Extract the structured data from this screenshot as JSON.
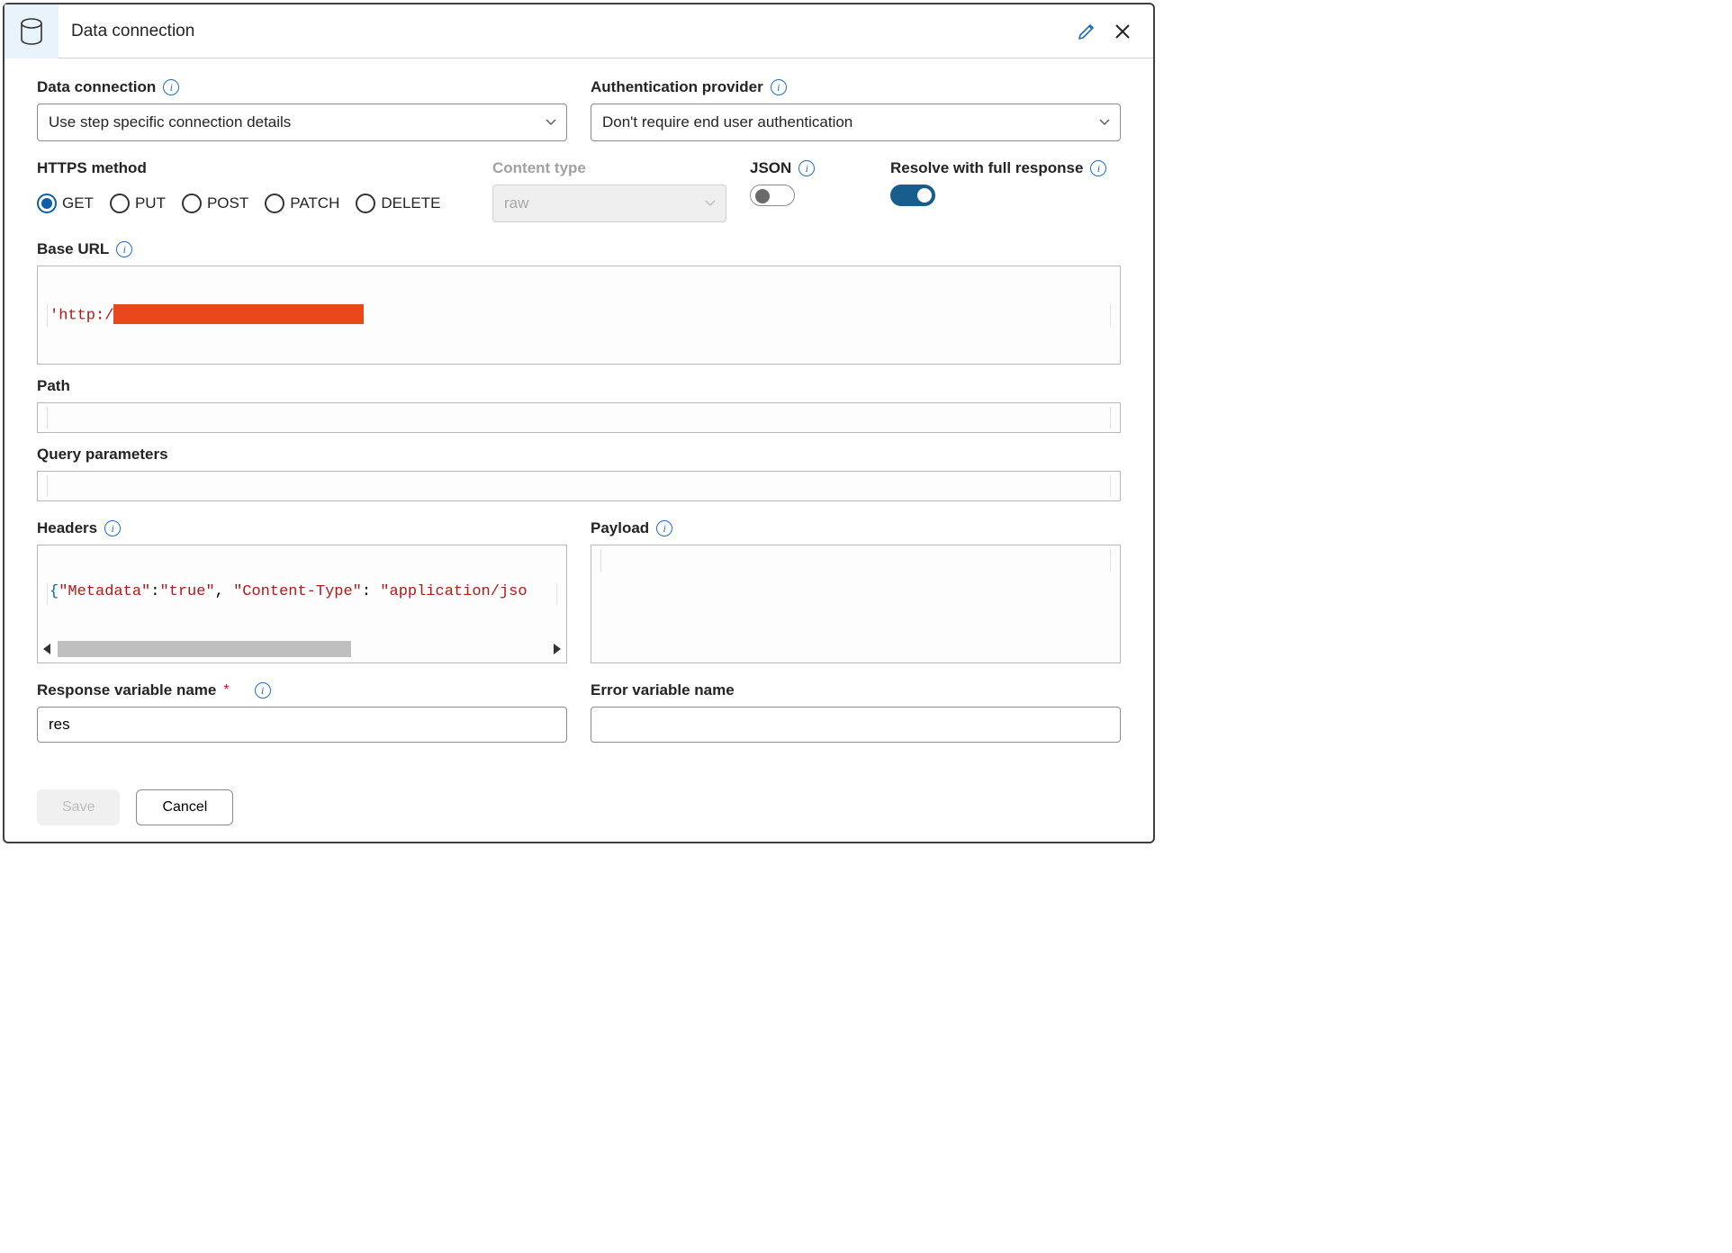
{
  "header": {
    "title": "Data connection"
  },
  "fields": {
    "data_connection": {
      "label": "Data connection",
      "value": "Use step specific connection details"
    },
    "auth_provider": {
      "label": "Authentication provider",
      "value": "Don't require end user authentication"
    },
    "https_method": {
      "label": "HTTPS method",
      "options": [
        "GET",
        "PUT",
        "POST",
        "PATCH",
        "DELETE"
      ],
      "selected": "GET"
    },
    "content_type": {
      "label": "Content type",
      "value": "raw"
    },
    "json": {
      "label": "JSON",
      "on": false
    },
    "resolve": {
      "label": "Resolve with full response",
      "on": true
    },
    "base_url": {
      "label": "Base URL",
      "prefix": "'http:/"
    },
    "path": {
      "label": "Path",
      "value": ""
    },
    "query_params": {
      "label": "Query parameters",
      "value": ""
    },
    "headers": {
      "label": "Headers",
      "tokens": {
        "open": "{",
        "k1": "\"Metadata\"",
        "c1": ":",
        "v1": "\"true\"",
        "comma": ", ",
        "k2": "\"Content-Type\"",
        "c2": ": ",
        "v2": "\"application/jso"
      }
    },
    "payload": {
      "label": "Payload",
      "value": ""
    },
    "response_var": {
      "label": "Response variable name",
      "value": "res"
    },
    "error_var": {
      "label": "Error variable name",
      "value": ""
    }
  },
  "footer": {
    "save": "Save",
    "cancel": "Cancel"
  }
}
